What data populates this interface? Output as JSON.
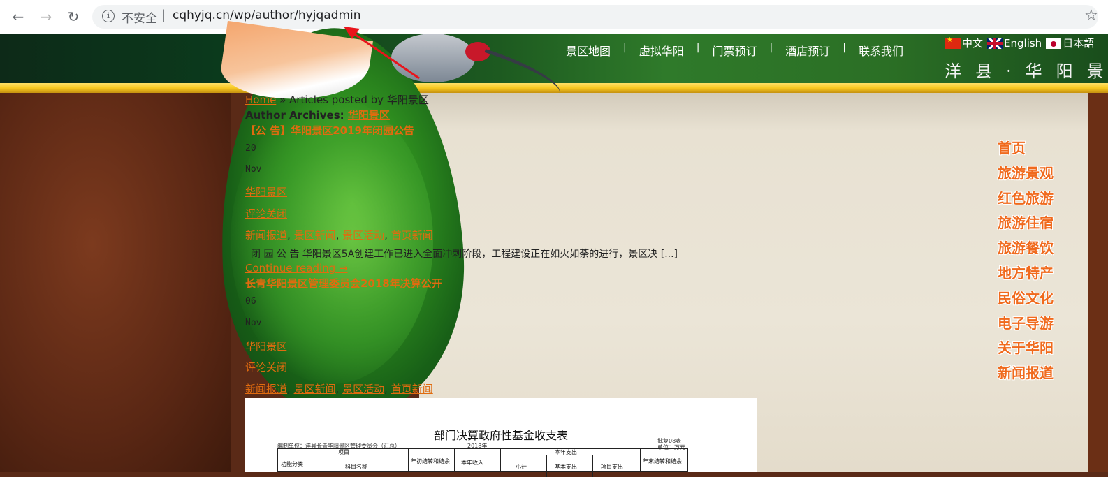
{
  "browser": {
    "back_icon": "arrow-left-icon",
    "forward_icon": "arrow-right-icon",
    "reload_icon": "reload-icon",
    "security_label": "不安全",
    "separator": "|",
    "url": "cqhyjq.cn/wp/author/hyjqadmin",
    "info_icon_glyph": "i"
  },
  "header": {
    "nav": [
      "景区地图",
      "虚拟华阳",
      "门票预订",
      "酒店预订",
      "联系我们"
    ],
    "nav_separator": "|",
    "languages": [
      "中文",
      "English",
      "日本語"
    ],
    "calligraphy": "洋县·华阳景区"
  },
  "breadcrumb": {
    "home": "Home",
    "separator": "»",
    "current": "Articles posted by 华阳景区"
  },
  "author_archive": {
    "label": "Author Archives:",
    "author": "华阳景区"
  },
  "posts": [
    {
      "title": "【公 告】华阳景区2019年闭园公告",
      "day": "20",
      "month": "Nov",
      "author": "华阳景区",
      "comments": "评论关闭",
      "categories": [
        "新闻报道",
        "景区新闻",
        "景区活动",
        "首页新闻"
      ],
      "excerpt": "闭 园 公 告 华阳景区5A创建工作已进入全面冲刺阶段，工程建设正在如火如荼的进行，景区决 [...]",
      "continue": "Continue reading →"
    },
    {
      "title": "长青华阳景区管理委员会2018年决算公开",
      "day": "06",
      "month": "Nov",
      "author": "华阳景区",
      "comments": "评论关闭",
      "categories": [
        "新闻报道",
        "景区新闻",
        "景区活动",
        "首页新闻"
      ]
    }
  ],
  "category_separator": ",",
  "report_image": {
    "title": "部门决算政府性基金收支表",
    "unit": "编制单位：洋县长青华阳景区管理委员会（汇总）",
    "year": "2018年",
    "table_no": "批复08表",
    "currency": "单位：万元",
    "headers": [
      "项目",
      "年初结转和结余",
      "本年收入",
      "本年支出",
      "年末结转和结余"
    ],
    "sub_headers": [
      "功能分类",
      "科目名称",
      "小计",
      "基本支出",
      "项目支出"
    ]
  },
  "side_menu": [
    "首页",
    "旅游景观",
    "红色旅游",
    "旅游住宿",
    "旅游餐饮",
    "地方特产",
    "民俗文化",
    "电子导游",
    "关于华阳",
    "新闻报道"
  ],
  "colors": {
    "link": "#e06b0f",
    "side_menu": "#f06a1d",
    "annotation": "#e8141b"
  }
}
